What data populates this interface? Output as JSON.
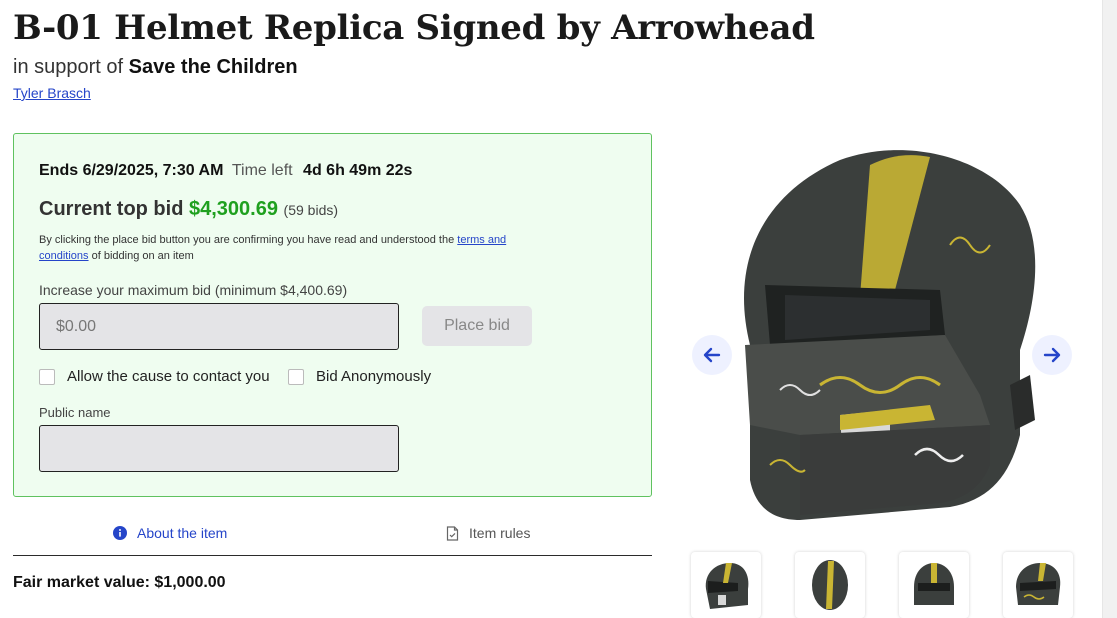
{
  "item": {
    "title": "B-01 Helmet Replica Signed by Arrowhead",
    "support_prefix": "in support of",
    "cause": "Save the Children",
    "author": "Tyler Brasch"
  },
  "bid": {
    "ends_label": "Ends 6/29/2025, 7:30 AM",
    "time_left_label": "Time left",
    "time_left_value": "4d 6h 49m 22s",
    "current_label": "Current top bid",
    "current_amount": "$4,300.69",
    "bid_count": "(59 bids)",
    "terms_prefix": "By clicking the place bid button you are confirming you have read and understood the ",
    "terms_link": "terms and conditions",
    "terms_suffix": " of bidding on an item",
    "increase_label": "Increase your maximum bid (minimum $4,400.69)",
    "input_placeholder": "$0.00",
    "place_bid_label": "Place bid",
    "allow_contact_label": "Allow the cause to contact you",
    "anonymous_label": "Bid Anonymously",
    "public_name_label": "Public name",
    "public_name_value": ""
  },
  "tabs": [
    {
      "label": "About the item",
      "icon": "info-icon",
      "active": true
    },
    {
      "label": "Item rules",
      "icon": "document-icon",
      "active": false
    }
  ],
  "fair_market_value": "Fair market value: $1,000.00",
  "gallery": {
    "main_image": "helmet-image",
    "thumbnails": [
      "helmet-side-thumb",
      "helmet-top-thumb",
      "helmet-front-thumb",
      "helmet-angle-thumb"
    ]
  },
  "colors": {
    "accent": "#2545c9",
    "bid_green": "#1fa01f",
    "box_bg": "#effdf0",
    "box_border": "#5fc25f"
  }
}
